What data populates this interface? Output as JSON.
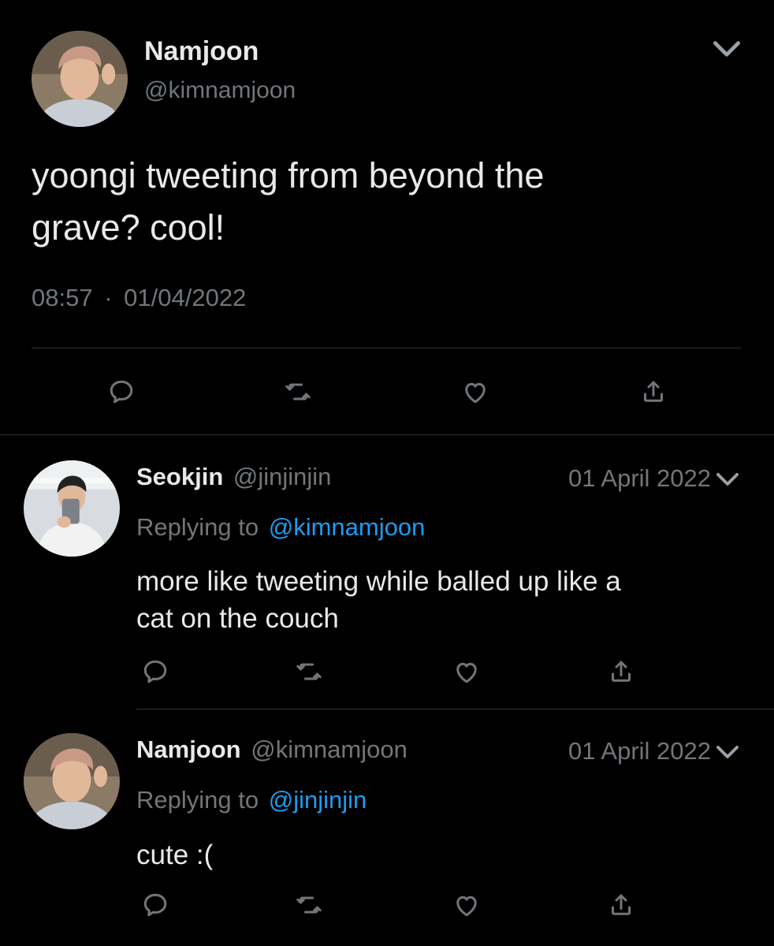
{
  "main_tweet": {
    "author_name": "Namjoon",
    "author_handle": "@kimnamjoon",
    "text_line1": "yoongi tweeting from beyond the",
    "text_line2": "grave? cool!",
    "time": "08:57",
    "separator": "·",
    "date": "01/04/2022"
  },
  "replies": [
    {
      "author_name": "Seokjin",
      "author_handle": "@jinjinjin",
      "date": "01 April 2022",
      "replying_prefix": "Replying to",
      "replying_to": "@kimnamjoon",
      "text_line1": "more like tweeting while balled up like a",
      "text_line2": "cat on the couch"
    },
    {
      "author_name": "Namjoon",
      "author_handle": "@kimnamjoon",
      "date": "01 April 2022",
      "replying_prefix": "Replying to",
      "replying_to": "@jinjinjin",
      "text_line1": "cute :("
    }
  ],
  "icons": [
    "reply-icon",
    "retweet-icon",
    "like-icon",
    "share-icon",
    "chevron-down-icon"
  ],
  "colors": {
    "background": "#000000",
    "text": "#e7e9ea",
    "secondary": "#71767b",
    "link": "#1d9bf0",
    "divider": "#2f3336"
  }
}
